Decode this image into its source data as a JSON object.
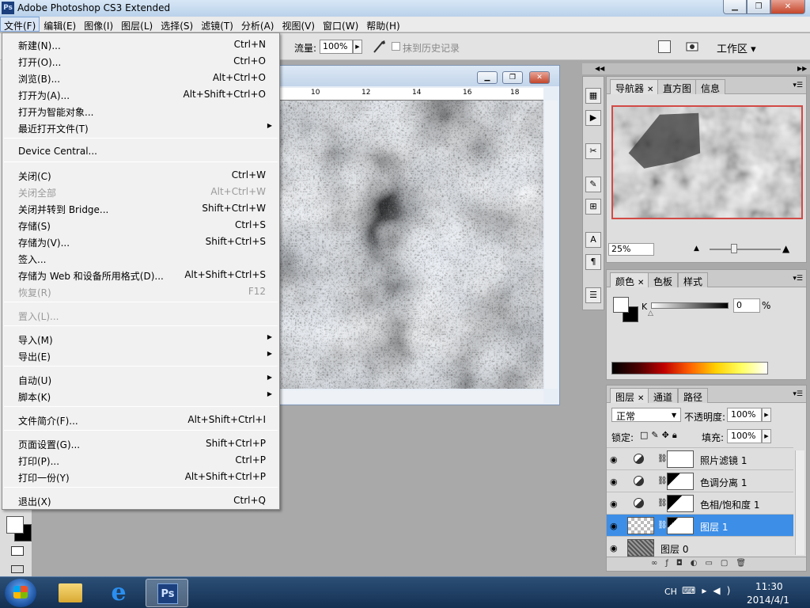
{
  "window": {
    "title": "Adobe Photoshop CS3 Extended",
    "app_icon": "Ps"
  },
  "menubar": [
    "文件(F)",
    "编辑(E)",
    "图像(I)",
    "图层(L)",
    "选择(S)",
    "滤镜(T)",
    "分析(A)",
    "视图(V)",
    "窗口(W)",
    "帮助(H)"
  ],
  "options": {
    "flow_label": "流量:",
    "flow_value": "100%",
    "history_label": "抹到历史记录",
    "workspace_label": "工作区 ▾"
  },
  "document": {
    "ruler_ticks": [
      "10",
      "12",
      "14",
      "16",
      "18"
    ]
  },
  "file_menu": {
    "items": [
      {
        "label": "新建(N)...",
        "shortcut": "Ctrl+N"
      },
      {
        "label": "打开(O)...",
        "shortcut": "Ctrl+O"
      },
      {
        "label": "浏览(B)...",
        "shortcut": "Alt+Ctrl+O"
      },
      {
        "label": "打开为(A)...",
        "shortcut": "Alt+Shift+Ctrl+O"
      },
      {
        "label": "打开为智能对象...",
        "shortcut": ""
      },
      {
        "label": "最近打开文件(T)",
        "shortcut": "",
        "submenu": true
      },
      {
        "label": "Device Central...",
        "shortcut": ""
      },
      {
        "label": "关闭(C)",
        "shortcut": "Ctrl+W"
      },
      {
        "label": "关闭全部",
        "shortcut": "Alt+Ctrl+W",
        "disabled": true
      },
      {
        "label": "关闭并转到 Bridge...",
        "shortcut": "Shift+Ctrl+W"
      },
      {
        "label": "存储(S)",
        "shortcut": "Ctrl+S"
      },
      {
        "label": "存储为(V)...",
        "shortcut": "Shift+Ctrl+S"
      },
      {
        "label": "签入...",
        "shortcut": ""
      },
      {
        "label": "存储为 Web 和设备所用格式(D)...",
        "shortcut": "Alt+Shift+Ctrl+S"
      },
      {
        "label": "恢复(R)",
        "shortcut": "F12",
        "disabled": true
      },
      {
        "label": "置入(L)...",
        "shortcut": "",
        "disabled": true
      },
      {
        "label": "导入(M)",
        "shortcut": "",
        "submenu": true
      },
      {
        "label": "导出(E)",
        "shortcut": "",
        "submenu": true
      },
      {
        "label": "自动(U)",
        "shortcut": "",
        "submenu": true
      },
      {
        "label": "脚本(K)",
        "shortcut": "",
        "submenu": true
      },
      {
        "label": "文件简介(F)...",
        "shortcut": "Alt+Shift+Ctrl+I"
      },
      {
        "label": "页面设置(G)...",
        "shortcut": "Shift+Ctrl+P"
      },
      {
        "label": "打印(P)...",
        "shortcut": "Ctrl+P"
      },
      {
        "label": "打印一份(Y)",
        "shortcut": "Alt+Shift+Ctrl+P"
      },
      {
        "label": "退出(X)",
        "shortcut": "Ctrl+Q"
      }
    ]
  },
  "navigator_panel": {
    "tabs": [
      "导航器",
      "直方图",
      "信息"
    ],
    "zoom": "25%"
  },
  "color_panel": {
    "tabs": [
      "颜色",
      "色板",
      "样式"
    ],
    "channel_label": "K",
    "value": "0",
    "unit": "%"
  },
  "layers_panel": {
    "tabs": [
      "图层",
      "通道",
      "路径"
    ],
    "blend_mode": "正常",
    "opacity_label": "不透明度:",
    "opacity": "100%",
    "lock_label": "锁定:",
    "fill_label": "填充:",
    "fill": "100%",
    "layers": [
      {
        "name": "照片滤镜 1",
        "type": "adjustment"
      },
      {
        "name": "色调分离 1",
        "type": "adjustment"
      },
      {
        "name": "色相/饱和度 1",
        "type": "adjustment"
      },
      {
        "name": "图层 1",
        "type": "layer",
        "selected": true
      },
      {
        "name": "图层 0",
        "type": "base"
      }
    ]
  },
  "taskbar": {
    "lang": "CH",
    "time": "11:30",
    "date": "2014/4/1"
  }
}
